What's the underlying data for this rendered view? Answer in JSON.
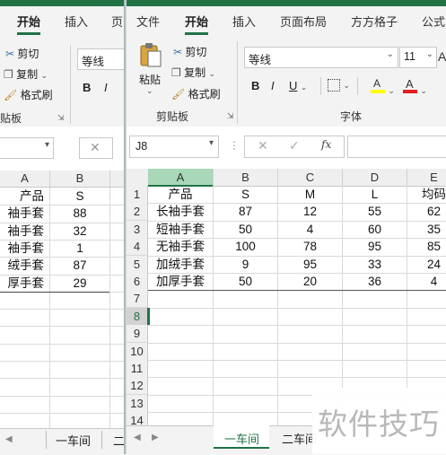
{
  "back_window": {
    "ribbon_tabs": [
      "开始",
      "插入",
      "页"
    ],
    "clipboard": {
      "cut": "剪切",
      "copy": "复制",
      "format_painter": "格式刷",
      "group": "贴板"
    },
    "font_name": "等线",
    "bold": "B",
    "italic": "I",
    "column_headers": [
      "A",
      "B"
    ],
    "rows": [
      [
        "产品",
        "S"
      ],
      [
        "袖手套",
        "88"
      ],
      [
        "袖手套",
        "32"
      ],
      [
        "袖手套",
        "1"
      ],
      [
        "绒手套",
        "87"
      ],
      [
        "厚手套",
        "29"
      ]
    ],
    "sheet_tabs": [
      "一车间",
      "二"
    ]
  },
  "front_window": {
    "ribbon_tabs": [
      "文件",
      "开始",
      "插入",
      "页面布局",
      "方方格子",
      "公式"
    ],
    "active_tab": "开始",
    "clipboard": {
      "paste": "粘贴",
      "cut": "剪切",
      "copy": "复制",
      "format_painter": "格式刷",
      "group": "剪贴板"
    },
    "font": {
      "name": "等线",
      "size": "11",
      "bold": "B",
      "italic": "I",
      "underline": "U",
      "fill_color_glyph": "A",
      "font_color_glyph": "A",
      "group": "字体"
    },
    "colors": {
      "accent": "#217346",
      "highlight": "#ffff00",
      "font_red": "#e02020",
      "selected_header": "#a9d8b8"
    },
    "name_box": "J8",
    "formula_icons": {
      "cancel": "✕",
      "enter": "✓",
      "fx": "fx"
    },
    "column_headers": [
      "A",
      "B",
      "C",
      "D",
      "E"
    ],
    "row_headers": [
      "1",
      "2",
      "3",
      "4",
      "5",
      "6",
      "7",
      "8",
      "9",
      "10",
      "11",
      "12",
      "13",
      "14"
    ],
    "selected_row": "8",
    "rows": [
      [
        "产品",
        "S",
        "M",
        "L",
        "均码"
      ],
      [
        "长袖手套",
        "87",
        "12",
        "55",
        "62"
      ],
      [
        "短袖手套",
        "50",
        "4",
        "60",
        "35"
      ],
      [
        "无袖手套",
        "100",
        "78",
        "95",
        "85"
      ],
      [
        "加绒手套",
        "9",
        "95",
        "33",
        "24"
      ],
      [
        "加厚手套",
        "50",
        "20",
        "36",
        "4"
      ]
    ],
    "sheet_tabs": [
      "一车间",
      "二车间"
    ],
    "active_sheet": "一车间"
  },
  "watermark": "软件技巧"
}
